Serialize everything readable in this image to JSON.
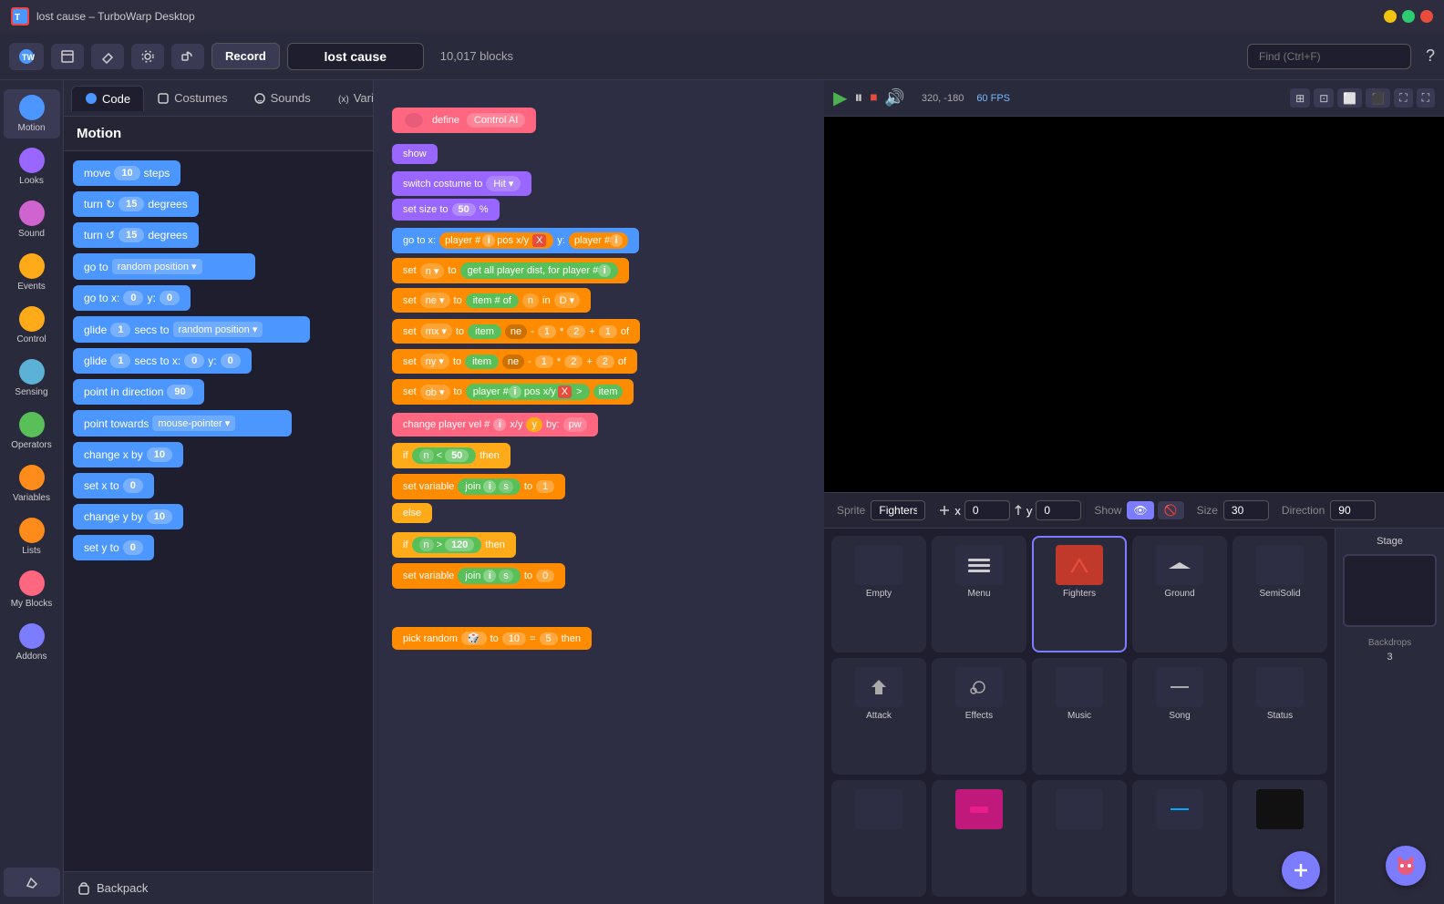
{
  "titlebar": {
    "title": "lost cause – TurboWarp Desktop",
    "app_icon": "TW"
  },
  "toolbar": {
    "record_label": "Record",
    "project_name": "lost cause",
    "block_count": "10,017 blocks",
    "find_placeholder": "Find (Ctrl+F)"
  },
  "tabs": {
    "code_label": "Code",
    "costumes_label": "Costumes",
    "sounds_label": "Sounds",
    "variables_label": "Variables"
  },
  "categories": [
    {
      "id": "motion",
      "label": "Motion",
      "color": "#4c97ff"
    },
    {
      "id": "looks",
      "label": "Looks",
      "color": "#9966ff"
    },
    {
      "id": "sound",
      "label": "Sound",
      "color": "#cf63cf"
    },
    {
      "id": "events",
      "label": "Events",
      "color": "#ffab19"
    },
    {
      "id": "control",
      "label": "Control",
      "color": "#ffab19"
    },
    {
      "id": "sensing",
      "label": "Sensing",
      "color": "#5cb1d6"
    },
    {
      "id": "operators",
      "label": "Operators",
      "color": "#59c059"
    },
    {
      "id": "variables",
      "label": "Variables",
      "color": "#ff8c1a"
    },
    {
      "id": "lists",
      "label": "Lists",
      "color": "#ff8c1a"
    },
    {
      "id": "myblocks",
      "label": "My Blocks",
      "color": "#ff6680"
    },
    {
      "id": "addons",
      "label": "Addons",
      "color": "#ff6680"
    }
  ],
  "motion_header": "Motion",
  "blocks": [
    {
      "id": "move",
      "text": "move",
      "val": "10",
      "suffix": "steps",
      "type": "motion"
    },
    {
      "id": "turn_right",
      "text": "turn ↻",
      "val": "15",
      "suffix": "degrees",
      "type": "motion"
    },
    {
      "id": "turn_left",
      "text": "turn ↺",
      "val": "15",
      "suffix": "degrees",
      "type": "motion"
    },
    {
      "id": "goto_random",
      "text": "go to",
      "dropdown": "random position ▾",
      "type": "motion"
    },
    {
      "id": "goto_xy",
      "text": "go to x:",
      "val1": "0",
      "suffix2": "y:",
      "val2": "0",
      "type": "motion"
    },
    {
      "id": "glide_random",
      "text": "glide",
      "val": "1",
      "suffix": "secs to",
      "dropdown": "random position ▾",
      "type": "motion"
    },
    {
      "id": "glide_xy",
      "text": "glide",
      "val": "1",
      "suffix": "secs to x:",
      "val2": "0",
      "suffix2": "y:",
      "val3": "0",
      "type": "motion"
    },
    {
      "id": "point_dir",
      "text": "point in direction",
      "val": "90",
      "type": "motion"
    },
    {
      "id": "point_towards",
      "text": "point towards",
      "dropdown": "mouse-pointer ▾",
      "type": "motion"
    },
    {
      "id": "change_x",
      "text": "change x by",
      "val": "10",
      "type": "motion"
    },
    {
      "id": "set_x",
      "text": "set x to",
      "val": "0",
      "type": "motion"
    },
    {
      "id": "change_y",
      "text": "change y by",
      "val": "10",
      "type": "motion"
    },
    {
      "id": "set_y",
      "text": "set y to",
      "val": "0",
      "type": "motion"
    }
  ],
  "backpack_label": "Backpack",
  "stage_controls": {
    "coords": "320, -180",
    "fps": "60 FPS"
  },
  "sprite_info": {
    "sprite_label": "Sprite",
    "sprite_name": "Fighters",
    "x_label": "x",
    "x_val": "0",
    "y_label": "y",
    "y_val": "0",
    "show_label": "Show",
    "size_label": "Size",
    "size_val": "30",
    "direction_label": "Direction",
    "direction_val": "90"
  },
  "sprites": [
    {
      "id": "empty",
      "label": "Empty",
      "selected": false,
      "color": "#3a3a55"
    },
    {
      "id": "menu",
      "label": "Menu",
      "selected": false,
      "color": "#3a3a55"
    },
    {
      "id": "fighters",
      "label": "Fighters",
      "selected": true,
      "color": "#c0392b"
    },
    {
      "id": "ground",
      "label": "Ground",
      "selected": false,
      "color": "#3a3a55"
    },
    {
      "id": "semisolid",
      "label": "SemiSolid",
      "selected": false,
      "color": "#3a3a55"
    },
    {
      "id": "attack",
      "label": "Attack",
      "selected": false,
      "color": "#3a3a55"
    },
    {
      "id": "effects",
      "label": "Effects",
      "selected": false,
      "color": "#3a3a55"
    },
    {
      "id": "music",
      "label": "Music",
      "selected": false,
      "color": "#3a3a55"
    },
    {
      "id": "song",
      "label": "Song",
      "selected": false,
      "color": "#3a3a55"
    },
    {
      "id": "status",
      "label": "Status",
      "selected": false,
      "color": "#3a3a55"
    },
    {
      "id": "sprite11",
      "label": "",
      "selected": false,
      "color": "#3a3a55"
    },
    {
      "id": "sprite12",
      "label": "",
      "selected": false,
      "color": "#c0197b"
    },
    {
      "id": "sprite13",
      "label": "",
      "selected": false,
      "color": "#3a3a55"
    },
    {
      "id": "sprite14",
      "label": "",
      "selected": false,
      "color": "#00aaff"
    },
    {
      "id": "sprite15",
      "label": "",
      "selected": false,
      "color": "#1a1a2e"
    }
  ],
  "stage_section": {
    "label": "Stage",
    "backdrops_label": "Backdrops",
    "backdrops_count": "3"
  }
}
